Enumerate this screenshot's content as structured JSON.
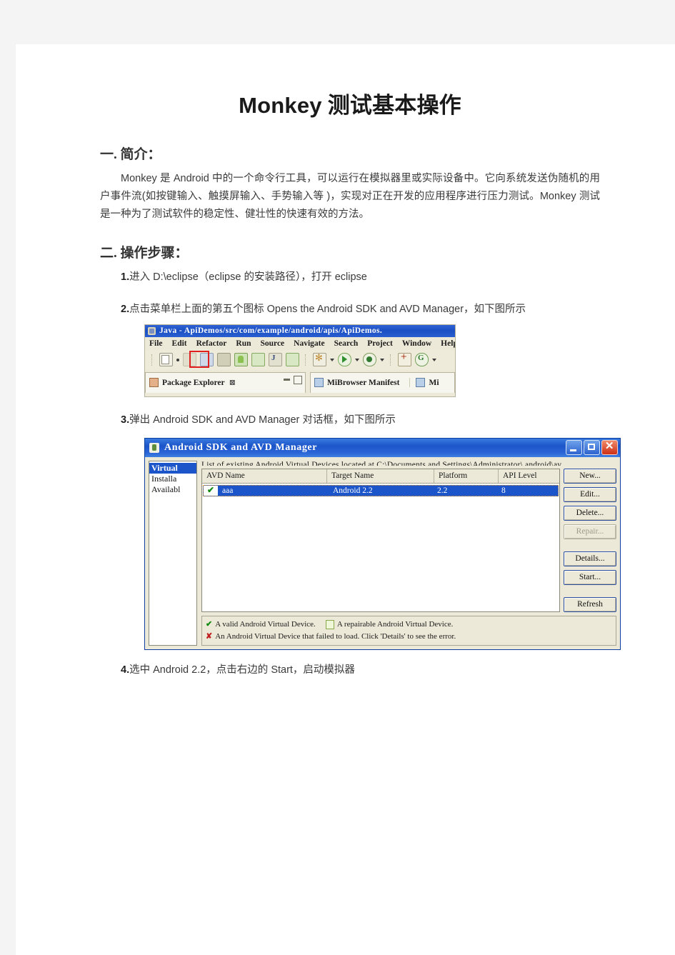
{
  "document": {
    "title_latin": "Monkey",
    "title_cjk": "测试基本操作"
  },
  "sections": {
    "one": {
      "heading": "一. 简介：",
      "paragraph": "Monkey 是 Android 中的一个命令行工具，可以运行在模拟器里或实际设备中。它向系统发送伪随机的用户事件流(如按键输入、触摸屏输入、手势输入等 )，实现对正在开发的应用程序进行压力测试。Monkey 测试是一种为了测试软件的稳定性、健壮性的快速有效的方法。"
    },
    "two": {
      "heading": "二. 操作步骤：",
      "steps": [
        {
          "num": "1.",
          "text": "进入 D:\\eclipse（eclipse 的安装路径），打开 eclipse"
        },
        {
          "num": "2.",
          "text": "点击菜单栏上面的第五个图标 Opens   the   Android   SDK   and   AVD   Manager，如下图所示"
        },
        {
          "num": "3.",
          "text": "弹出 Android   SDK   and   AVD   Manager 对话框，如下图所示"
        },
        {
          "num": "4.",
          "text": "选中 Android  2.2，点击右边的 Start，启动模拟器"
        }
      ]
    }
  },
  "eclipse_screenshot": {
    "title": "Java - ApiDemos/src/com/example/android/apis/ApiDemos.",
    "menu": [
      "File",
      "Edit",
      "Refactor",
      "Run",
      "Source",
      "Navigate",
      "Search",
      "Project",
      "Window",
      "Help"
    ],
    "toolbar_icons": [
      "new-wizard-icon",
      "dropdown-caret-icon",
      "save-icon",
      "save-all-icon",
      "print-icon",
      "android-sdk-avd-manager-icon",
      "android-sdk-manager-icon",
      "javadoc-icon",
      "android-ddms-icon",
      "external-tools-icon",
      "run-icon",
      "debug-icon",
      "coverage-icon",
      "git-icon"
    ],
    "highlighted_icon": "android-sdk-avd-manager-icon",
    "highlight_color": "#e02020",
    "panel_left_tab": "Package Explorer",
    "panel_right_tab": "MiBrowser Manifest",
    "panel_right_tab_partial": "Mi"
  },
  "avd_dialog": {
    "title": "Android SDK and AVD Manager",
    "window_buttons": [
      "minimize-button",
      "maximize-button",
      "close-button"
    ],
    "sidebar": [
      {
        "label": "Virtual",
        "selected": true
      },
      {
        "label": "Installa",
        "selected": false
      },
      {
        "label": "Availabl",
        "selected": false
      }
    ],
    "list_label": "List of existing Android Virtual Devices located at C:\\Documents and Settings\\Administrator\\.android\\av",
    "columns": [
      "AVD Name",
      "Target Name",
      "Platform",
      "API Level"
    ],
    "rows": [
      {
        "check": "✔",
        "name": "aaa",
        "target": "Android 2.2",
        "platform": "2.2",
        "api": "8",
        "selected": true
      }
    ],
    "buttons": [
      {
        "label": "New...",
        "enabled": true
      },
      {
        "label": "Edit...",
        "enabled": true
      },
      {
        "label": "Delete...",
        "enabled": true
      },
      {
        "label": "Repair...",
        "enabled": false
      },
      {
        "label": "Details...",
        "enabled": true
      },
      {
        "label": "Start...",
        "enabled": true
      },
      {
        "label": "Refresh",
        "enabled": true
      }
    ],
    "legend": {
      "valid": "A valid Android Virtual Device.",
      "repairable": "A repairable Android Virtual Device.",
      "failed": "An Android Virtual Device that failed to load. Click 'Details' to see the error."
    }
  }
}
